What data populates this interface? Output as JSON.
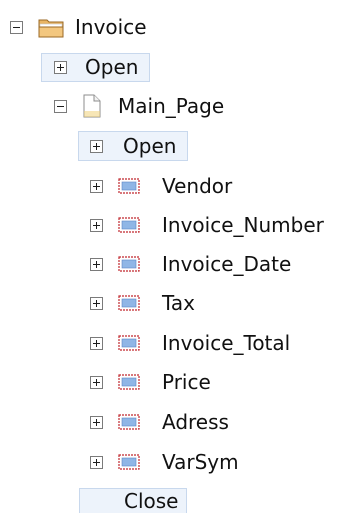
{
  "tree": {
    "root": {
      "label": "Invoice",
      "icon": "folder-icon",
      "expanded": true,
      "open_label": "Open",
      "child": {
        "label": "Main_Page",
        "icon": "page-icon",
        "expanded": true,
        "open_label": "Open",
        "fields": [
          {
            "label": "Vendor",
            "icon": "field-icon"
          },
          {
            "label": "Invoice_Number",
            "icon": "field-icon"
          },
          {
            "label": "Invoice_Date",
            "icon": "field-icon"
          },
          {
            "label": "Tax",
            "icon": "field-icon"
          },
          {
            "label": "Invoice_Total",
            "icon": "field-icon"
          },
          {
            "label": "Price",
            "icon": "field-icon"
          },
          {
            "label": "Adress",
            "icon": "field-icon"
          },
          {
            "label": "VarSym",
            "icon": "field-icon"
          }
        ],
        "close_label": "Close"
      }
    }
  },
  "colors": {
    "selection_bg": "#edf3fb",
    "selection_border": "#c8d8ed",
    "folder": "#d9a04e",
    "field_icon": "#c0282f",
    "field_icon_fill": "#8fb6e6"
  }
}
